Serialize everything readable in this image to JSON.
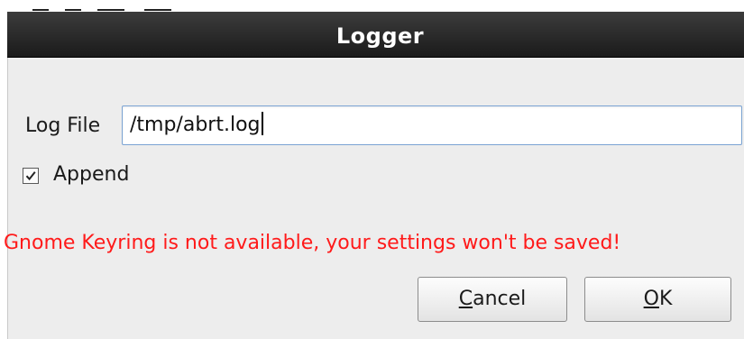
{
  "window": {
    "title": "Logger"
  },
  "form": {
    "log_file_label": "Log File",
    "log_file_value": "/tmp/abrt.log",
    "append_label": "Append",
    "append_checked": true
  },
  "warning": {
    "text": "Gnome Keyring is not available, your settings won't be saved!",
    "color": "#ff1a1a"
  },
  "buttons": {
    "cancel": {
      "mnemonic": "C",
      "rest": "ancel"
    },
    "ok": {
      "mnemonic": "O",
      "rest": "K"
    }
  },
  "colors": {
    "titlebar": "#1b1b1b",
    "dialog_bg": "#ededed",
    "input_border": "#7aa3d3"
  }
}
